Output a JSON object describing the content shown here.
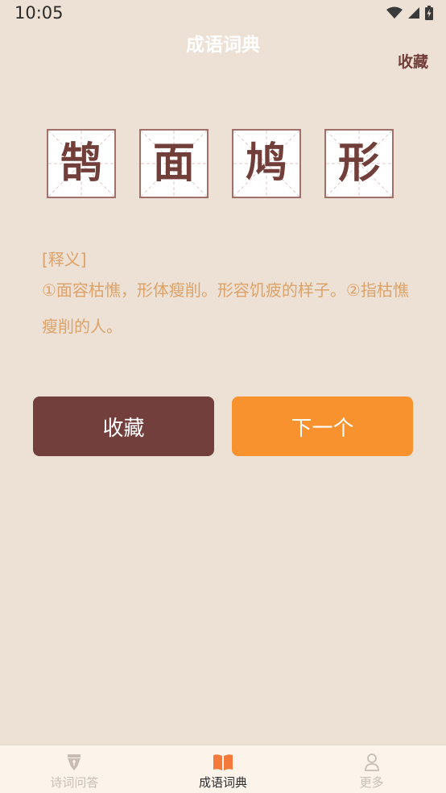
{
  "status_bar": {
    "time": "10:05"
  },
  "header": {
    "title": "成语词典",
    "favorite_link": "收藏"
  },
  "idiom": {
    "characters": [
      "鹄",
      "面",
      "鸠",
      "形"
    ]
  },
  "definition": {
    "label": "[释义]",
    "text": "①面容枯憔，形体瘦削。形容饥疲的样子。②指枯憔瘦削的人。"
  },
  "actions": {
    "favorite_label": "收藏",
    "next_label": "下一个"
  },
  "tabs": [
    {
      "label": "诗词问答",
      "icon": "pen-nib-icon",
      "active": false
    },
    {
      "label": "成语词典",
      "icon": "book-icon",
      "active": true
    },
    {
      "label": "更多",
      "icon": "user-icon",
      "active": false
    }
  ],
  "colors": {
    "background": "#ede0d4",
    "brand_brown": "#733f3c",
    "accent_orange": "#f7922f",
    "definition_text": "#dba36a"
  }
}
